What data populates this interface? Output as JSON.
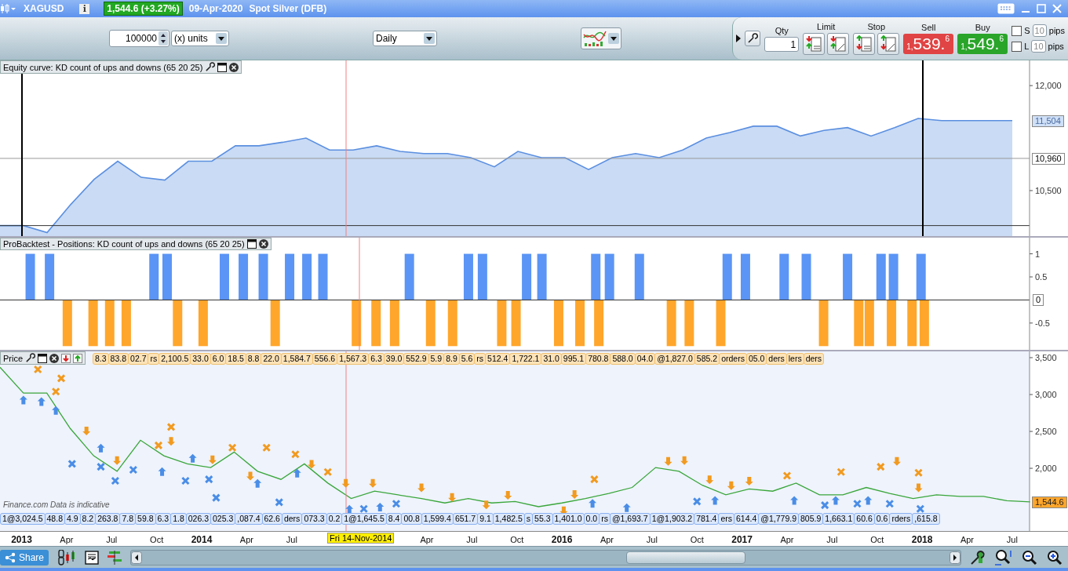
{
  "title_bar": {
    "symbol": "XAGUSD",
    "info_icon": "i",
    "change_badge": "1,544.6 (+3.27%)",
    "date": "09-Apr-2020",
    "instrument": "Spot Silver (DFB)"
  },
  "toolbar": {
    "quantity": "100000",
    "unit": "(x) units",
    "period": "Daily"
  },
  "trade_panel": {
    "qty_label": "Qty",
    "qty": "1",
    "limit_label": "Limit",
    "stop_label": "Stop",
    "prices": [
      {
        "kind": "sell",
        "label": "Sell",
        "prefix": "1,",
        "main": "539.",
        "pip": "6"
      },
      {
        "kind": "buy",
        "label": "Buy",
        "prefix": "1,",
        "main": "549.",
        "pip": "6"
      }
    ],
    "options": [
      {
        "label": "S",
        "checked": false,
        "pips": "10",
        "unit": "pips"
      },
      {
        "label": "L",
        "checked": false,
        "pips": "10",
        "unit": "pips"
      }
    ]
  },
  "equity_panel": {
    "title": "Equity curve: KD count of ups and downs (65 20 25)",
    "last_badge": "11,504",
    "chart_data": {
      "type": "area",
      "ylim": [
        9850,
        12360
      ],
      "yticks": [
        {
          "value": 10500,
          "label": "10,500"
        },
        {
          "value": 12000,
          "label": "12,000"
        }
      ],
      "ref_lines": [
        {
          "axis": "y",
          "value": 10960,
          "label": "10,960"
        },
        {
          "axis": "y",
          "value": 10000
        }
      ],
      "series": [
        {
          "color": "#5b8fe0",
          "values": [
            10000,
            10000,
            9900,
            10300,
            10660,
            10920,
            10690,
            10650,
            10920,
            10920,
            11140,
            11140,
            11190,
            11250,
            11080,
            11080,
            11140,
            11060,
            11030,
            11030,
            10970,
            10840,
            11060,
            10970,
            10970,
            10800,
            10970,
            11030,
            10970,
            11080,
            11250,
            11330,
            11420,
            11420,
            11280,
            11360,
            11400,
            11280,
            11400,
            11530,
            11500,
            11500,
            11500,
            11500
          ]
        }
      ]
    }
  },
  "positions_panel": {
    "title": "ProBacktest - Positions: KD count of ups and downs (65 20 25)",
    "zero_badge": "0",
    "chart_data": {
      "type": "bar",
      "xlim": [
        2012.88,
        2018.81
      ],
      "ylim": [
        -1.08,
        1.35
      ],
      "yticks": [
        {
          "value": 1,
          "label": "1"
        },
        {
          "value": 0.5,
          "label": "0.5"
        },
        {
          "value": -0.5,
          "label": "-0.5"
        }
      ],
      "x": [
        2013.048,
        2013.155,
        2013.254,
        2013.397,
        2013.489,
        2013.581,
        2013.735,
        2013.808,
        2013.866,
        2014.008,
        2014.126,
        2014.231,
        2014.342,
        2014.408,
        2014.488,
        2014.584,
        2014.673,
        2014.859,
        2014.968,
        2015.071,
        2015.153,
        2015.271,
        2015.393,
        2015.481,
        2015.559,
        2015.666,
        2015.745,
        2015.804,
        2015.889,
        2015.982,
        2016.1,
        2016.188,
        2016.205,
        2016.264,
        2016.43,
        2016.608,
        2016.707,
        2016.882,
        2016.918,
        2017.019,
        2017.234,
        2017.357,
        2017.453,
        2017.586,
        2017.648,
        2017.707,
        2017.772,
        2017.83,
        2017.841,
        2017.944,
        2017.994,
        2018.012
      ],
      "series": [
        {
          "color": "#5b95f5",
          "values": [
            1,
            1,
            null,
            null,
            null,
            null,
            1,
            1,
            null,
            null,
            1,
            1,
            1,
            null,
            1,
            1,
            1,
            null,
            null,
            null,
            1,
            null,
            null,
            1,
            1,
            null,
            null,
            1,
            1,
            null,
            null,
            1,
            null,
            1,
            1,
            null,
            null,
            null,
            1,
            1,
            1,
            1,
            null,
            1,
            null,
            null,
            1,
            null,
            1,
            null,
            1,
            null
          ]
        },
        {
          "color": "#ffa62b",
          "values": [
            null,
            null,
            -1,
            -1,
            -1,
            -1,
            null,
            null,
            -1,
            -1,
            null,
            null,
            null,
            -1,
            null,
            null,
            null,
            -1,
            -1,
            -1,
            null,
            -1,
            -1,
            null,
            null,
            -1,
            -1,
            null,
            null,
            -1,
            -1,
            null,
            -1,
            null,
            null,
            -1,
            -1,
            -1,
            null,
            null,
            null,
            null,
            -1,
            null,
            -1,
            -1,
            null,
            -1,
            null,
            -1,
            null,
            -1
          ]
        }
      ]
    }
  },
  "price_panel": {
    "title": "Price",
    "last_badge": "1,544.6",
    "top_orders": [
      "8.3",
      "83.8",
      "02.7",
      "rs",
      "2,100.5",
      "33.0",
      "6.0",
      "18.5",
      "8.8",
      "22.0",
      "1,584.7",
      "556.6",
      "1,567.3",
      "6.3",
      "39.0",
      "552.9",
      "5.9",
      "8.9",
      "5.6",
      "rs",
      "512.4",
      "1,722.1",
      "31.0",
      "995.1",
      "780.8",
      "588.0",
      "04.0",
      "@1,827.0",
      "585.2",
      "orders",
      "05.0",
      "ders",
      "lers",
      "ders"
    ],
    "bottom_orders": [
      "1@3,024.5",
      "48.8",
      "4.9",
      "8.2",
      "263.8",
      "7.8",
      "59.8",
      "6.3",
      "1.8",
      "026.3",
      "025.3",
      ",087.4",
      "62.6",
      "ders",
      "073.3",
      "0.2",
      "1@1,645.5",
      "8.4",
      "00.8",
      "1,599.4",
      "651.7",
      "9.1",
      "1,482.5",
      "s",
      "55.3",
      "1,401.0",
      "0.0",
      "rs",
      "@1,693.7",
      "1@1,903.2",
      "781.4",
      "ers",
      "614.4",
      "@1,779.9",
      "805.9",
      "1,663.1",
      "60.6",
      "0.6",
      "rders",
      ",615.8"
    ],
    "notice": "Finance.com Data is indicative",
    "chart_data": {
      "type": "line",
      "xlim": [
        2012.88,
        2018.81
      ],
      "ylim": [
        1150,
        3585
      ],
      "xticks": [
        {
          "value": 2013,
          "label": "2013"
        },
        {
          "value": 2013.25,
          "label": "Apr"
        },
        {
          "value": 2013.5,
          "label": "Jul"
        },
        {
          "value": 2013.75,
          "label": "Oct"
        },
        {
          "value": 2014,
          "label": "2014"
        },
        {
          "value": 2014.25,
          "label": "Apr"
        },
        {
          "value": 2014.5,
          "label": "Jul"
        },
        {
          "value": 2015.25,
          "label": "Apr"
        },
        {
          "value": 2015.5,
          "label": "Jul"
        },
        {
          "value": 2015.75,
          "label": "Oct"
        },
        {
          "value": 2016,
          "label": "2016"
        },
        {
          "value": 2016.25,
          "label": "Apr"
        },
        {
          "value": 2016.5,
          "label": "Jul"
        },
        {
          "value": 2016.75,
          "label": "Oct"
        },
        {
          "value": 2017,
          "label": "2017"
        },
        {
          "value": 2017.25,
          "label": "Apr"
        },
        {
          "value": 2017.5,
          "label": "Jul"
        },
        {
          "value": 2017.75,
          "label": "Oct"
        },
        {
          "value": 2018,
          "label": "2018"
        },
        {
          "value": 2018.25,
          "label": "Apr"
        },
        {
          "value": 2018.5,
          "label": "Jul"
        }
      ],
      "yticks": [
        {
          "value": 2000,
          "label": "2,000"
        },
        {
          "value": 2500,
          "label": "2,500"
        },
        {
          "value": 3000,
          "label": "3,000"
        },
        {
          "value": 3500,
          "label": "3,500"
        }
      ],
      "x": [
        2012.88,
        2013.01,
        2013.14,
        2013.27,
        2013.4,
        2013.53,
        2013.66,
        2013.79,
        2013.92,
        2014.05,
        2014.18,
        2014.31,
        2014.44,
        2014.57,
        2014.7,
        2014.83,
        2014.96,
        2015.09,
        2015.22,
        2015.35,
        2015.48,
        2015.61,
        2015.74,
        2015.87,
        2016,
        2016.13,
        2016.26,
        2016.39,
        2016.52,
        2016.65,
        2016.78,
        2016.91,
        2017.04,
        2017.17,
        2017.3,
        2017.43,
        2017.56,
        2017.69,
        2017.82,
        2017.95,
        2018.08,
        2018.21,
        2018.34,
        2018.47,
        2018.6
      ],
      "series": [
        {
          "color": "#3aa63a",
          "values": [
            3370,
            3020,
            3020,
            2540,
            2170,
            1960,
            2380,
            2170,
            2060,
            2010,
            2220,
            1960,
            1850,
            2060,
            1800,
            1590,
            1690,
            1640,
            1590,
            1530,
            1590,
            1530,
            1550,
            1480,
            1530,
            1590,
            1660,
            1740,
            2010,
            1960,
            1770,
            1640,
            1720,
            1690,
            1800,
            1640,
            1640,
            1740,
            1660,
            1590,
            1640,
            1620,
            1620,
            1560,
            1545
          ]
        }
      ]
    }
  },
  "time_axis": {
    "cursor_date": "Fri 14-Nov-2014"
  },
  "bottom_bar": {
    "share_label": "Share"
  }
}
